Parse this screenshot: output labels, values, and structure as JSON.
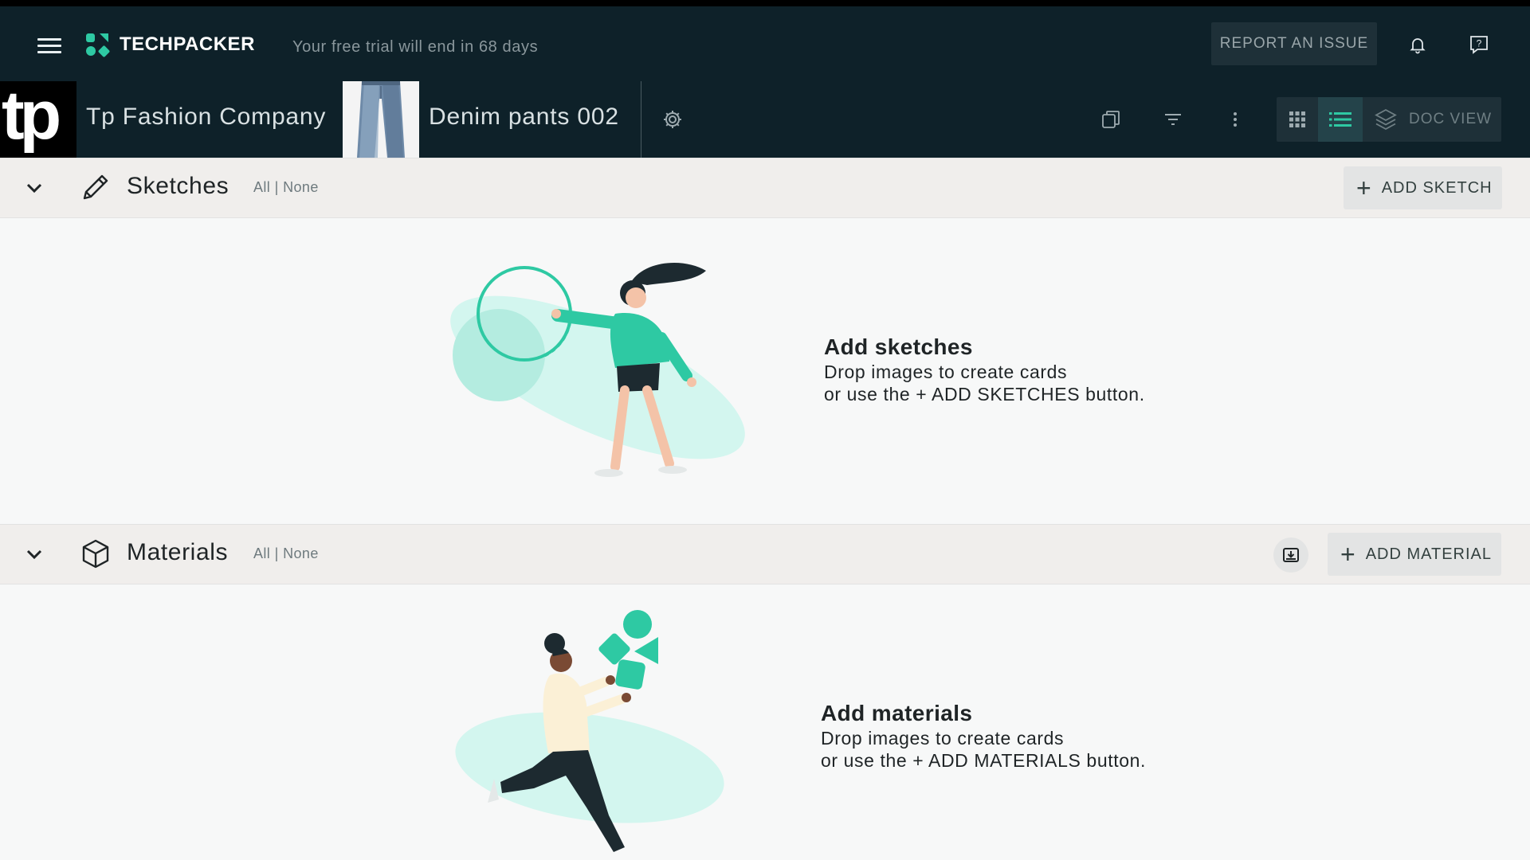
{
  "colors": {
    "topbar_bg": "#0e2129",
    "accent": "#2ec9a3",
    "accent_light": "#c9f3e8",
    "section_header_bg": "#f0eeec",
    "content_bg": "#f7f8f8"
  },
  "topbar": {
    "menu_icon": "hamburger-menu-icon",
    "brand": "TECHPACKER",
    "trial_text": "Your free trial will end in 68 days",
    "report_label": "REPORT AN ISSUE",
    "notifications_icon": "bell-icon",
    "help_icon": "help-chat-icon"
  },
  "docbar": {
    "company_logo": "tp",
    "company": "Tp Fashion Company",
    "product": "Denim pants 002",
    "settings_icon": "gear-icon",
    "copy_icon": "copy-icon",
    "filter_icon": "filter-icon",
    "more_icon": "more-vertical-icon",
    "views": {
      "grid_icon": "grid-view-icon",
      "list_icon": "list-view-icon",
      "doc_icon": "layers-icon",
      "doc_label": "DOC VIEW",
      "active": "list"
    }
  },
  "sketches": {
    "title": "Sketches",
    "all": "All",
    "separator": "|",
    "none": "None",
    "add_label": "ADD SKETCH",
    "empty_title": "Add sketches",
    "empty_line1": "Drop images to create cards",
    "empty_line2": "or use the + ADD SKETCHES button."
  },
  "materials": {
    "title": "Materials",
    "all": "All",
    "separator": "|",
    "none": "None",
    "import_icon": "import-icon",
    "add_label": "ADD MATERIAL",
    "empty_title": "Add materials",
    "empty_line1": "Drop images to create cards",
    "empty_line2": "or use the + ADD MATERIALS button."
  }
}
